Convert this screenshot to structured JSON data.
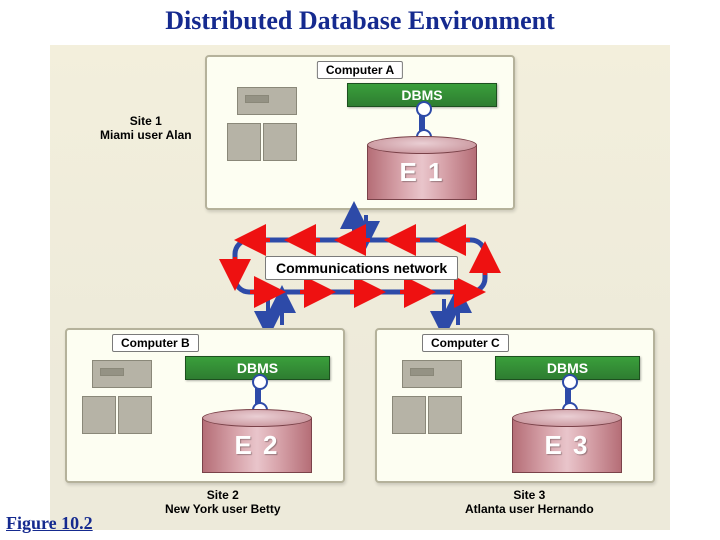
{
  "title": "Distributed Database Environment",
  "figure_label": "Figure 10.2",
  "comm_network_label": "Communications network",
  "sites": {
    "a": {
      "computer_label": "Computer A",
      "dbms_label": "DBMS",
      "db_label": "E 1",
      "site_caption_line1": "Site 1",
      "site_caption_line2": "Miami user Alan"
    },
    "b": {
      "computer_label": "Computer B",
      "dbms_label": "DBMS",
      "db_label": "E 2",
      "site_caption_line1": "Site 2",
      "site_caption_line2": "New York user Betty"
    },
    "c": {
      "computer_label": "Computer C",
      "dbms_label": "DBMS",
      "db_label": "E 3",
      "site_caption_line1": "Site 3",
      "site_caption_line2": "Atlanta user Hernando"
    }
  }
}
